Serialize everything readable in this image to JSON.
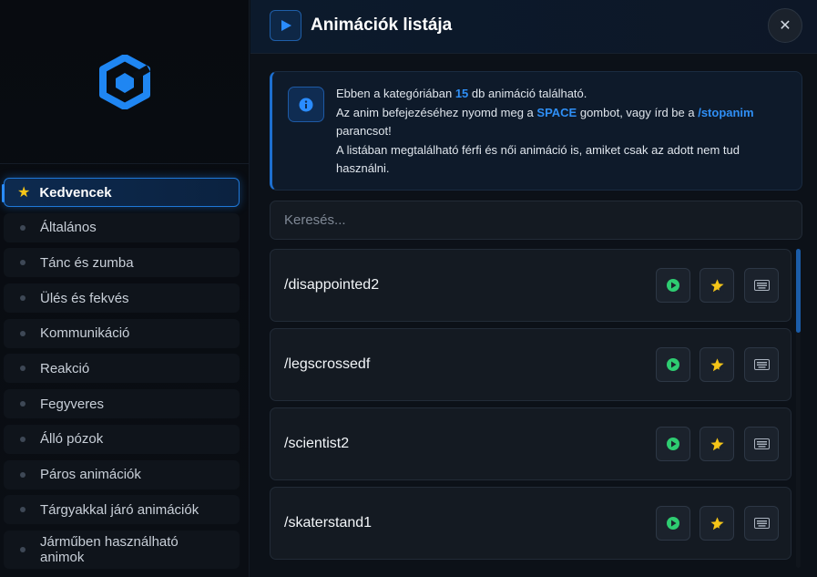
{
  "header": {
    "title": "Animációk listája"
  },
  "categories": [
    {
      "label": "Kedvencek",
      "active": true
    },
    {
      "label": "Általános"
    },
    {
      "label": "Tánc és zumba"
    },
    {
      "label": "Ülés és fekvés"
    },
    {
      "label": "Kommunikáció"
    },
    {
      "label": "Reakció"
    },
    {
      "label": "Fegyveres"
    },
    {
      "label": "Álló pózok"
    },
    {
      "label": "Páros animációk"
    },
    {
      "label": "Tárgyakkal járó animációk"
    },
    {
      "label": "Járműben használható animok"
    }
  ],
  "info": {
    "l1_a": "Ebben a kategóriában ",
    "count": "15",
    "l1_b": " db animáció található.",
    "l2_a": "Az anim befejezéséhez nyomd meg a ",
    "key": "SPACE",
    "l2_b": " gombot, vagy írd be a ",
    "cmd": "/stopanim",
    "l2_c": " parancsot!",
    "l3": "A listában megtalálható férfi és női animáció is, amiket csak az adott nem tud használni."
  },
  "search": {
    "placeholder": "Keresés..."
  },
  "animations": [
    "/disappointed2",
    "/legscrossedf",
    "/scientist2",
    "/skaterstand1"
  ],
  "colors": {
    "accent": "#2a8cff",
    "play": "#2ecc71",
    "star": "#f5c518"
  }
}
